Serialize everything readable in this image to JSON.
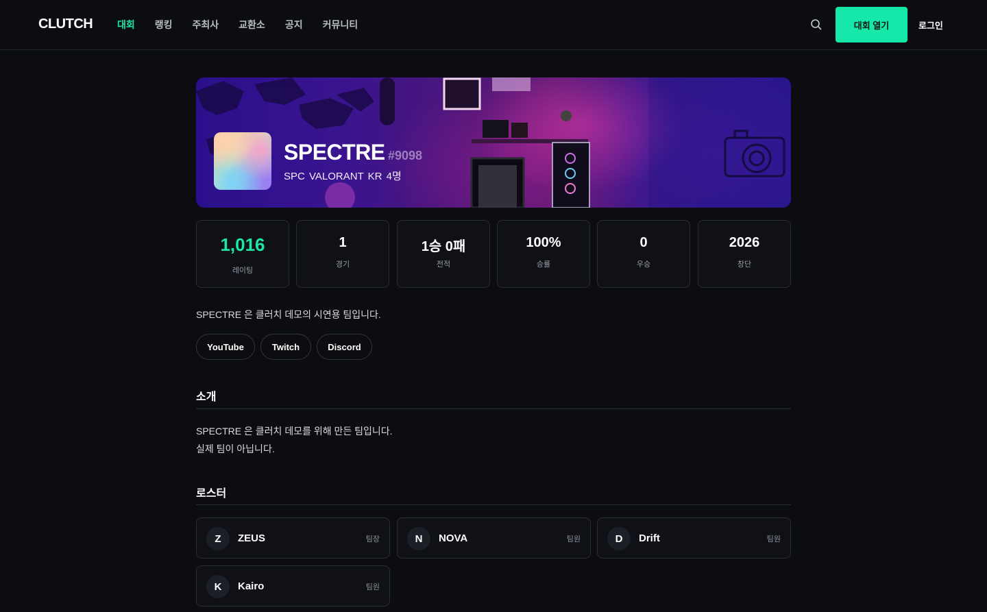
{
  "nav": {
    "logo": "CLUTCH",
    "menu": [
      {
        "label": "대회",
        "active": true
      },
      {
        "label": "랭킹"
      },
      {
        "label": "주최사"
      },
      {
        "label": "교환소"
      },
      {
        "label": "공지"
      },
      {
        "label": "커뮤니티"
      }
    ],
    "search_icon": "search-icon",
    "host_button": "대회 열기",
    "login": "로그인"
  },
  "team": {
    "name": "SPECTRE",
    "tag": "#9098",
    "meta": "SPC VALORANT KR 4명"
  },
  "stats": [
    {
      "value": "1,016",
      "label": "레이팅"
    },
    {
      "value": "1",
      "label": "경기"
    },
    {
      "value": "1승 0패",
      "label": "전적"
    },
    {
      "value": "100%",
      "label": "승률"
    },
    {
      "value": "0",
      "label": "우승"
    },
    {
      "value": "2026",
      "label": "창단"
    }
  ],
  "description": "SPECTRE 은 클러치 데모의 시연용 팀입니다.",
  "links": [
    "YouTube",
    "Twitch",
    "Discord"
  ],
  "intro": {
    "title": "소개",
    "lines": [
      "SPECTRE 은 클러치 데모를 위해 만든 팀입니다.",
      "실제 팀이 아닙니다."
    ]
  },
  "roster": {
    "title": "로스터",
    "members": [
      {
        "initial": "Z",
        "name": "ZEUS",
        "role": "팀장"
      },
      {
        "initial": "N",
        "name": "NOVA",
        "role": "팀원"
      },
      {
        "initial": "D",
        "name": "Drift",
        "role": "팀원"
      },
      {
        "initial": "K",
        "name": "Kairo",
        "role": "팀원"
      }
    ]
  },
  "colors": {
    "accent": "#1ee6a8",
    "background": "#0c0d11",
    "card_border": "#2a2c33"
  }
}
